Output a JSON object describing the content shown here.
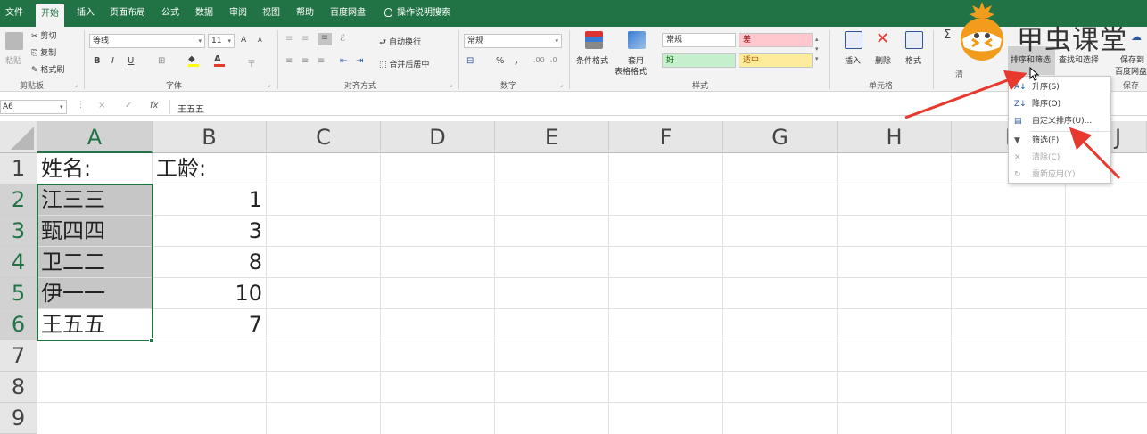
{
  "tabs": [
    "文件",
    "开始",
    "插入",
    "页面布局",
    "公式",
    "数据",
    "审阅",
    "视图",
    "帮助",
    "百度网盘"
  ],
  "tell_me": "操作说明搜索",
  "clipboard": {
    "paste": "粘贴",
    "cut": "剪切",
    "copy": "复制",
    "format_painter": "格式刷",
    "group": "剪贴板"
  },
  "font": {
    "name": "等线",
    "size": "11",
    "bold": "B",
    "italic": "I",
    "underline": "U",
    "grow": "A",
    "shrink": "A",
    "font_color_glyph": "A",
    "group": "字体"
  },
  "alignment": {
    "wrap": "自动换行",
    "merge": "合并后居中",
    "group": "对齐方式"
  },
  "number": {
    "format": "常规",
    "percent": "%",
    "comma": ",",
    "group": "数字"
  },
  "styles": {
    "conditional": "条件格式",
    "table_format": [
      "套用",
      "表格格式"
    ],
    "normal": "常规",
    "bad": "差",
    "good": "好",
    "neutral": "适中",
    "group": "样式",
    "colors": {
      "bad_bg": "#ffc7ce",
      "bad_text": "#9c0006",
      "good_bg": "#c6efce",
      "good_text": "#006100",
      "neutral_bg": "#ffeb9c",
      "neutral_text": "#9c5700"
    }
  },
  "cells": {
    "insert": "插入",
    "delete": "删除",
    "format": "格式",
    "group": "单元格"
  },
  "editing": {
    "sigma": "Σ",
    "sort_filter": "排序和筛选",
    "find_select": "查找和选择",
    "clear_partial": "清"
  },
  "save": {
    "label1": "保存到",
    "label2": "百度网盘",
    "group": "保存"
  },
  "watermark": "甲虫课堂",
  "formula_bar": {
    "name_box": "A6",
    "cancel": "×",
    "enter": "✓",
    "fx": "fx",
    "value": "王五五"
  },
  "columns": [
    "A",
    "B",
    "C",
    "D",
    "E",
    "F",
    "G",
    "H",
    "I",
    "J"
  ],
  "rows": [
    "1",
    "2",
    "3",
    "4",
    "5",
    "6",
    "7",
    "8",
    "9"
  ],
  "sheet": {
    "A1": "姓名:",
    "B1": "工龄:",
    "A2": "江三三",
    "B2": "1",
    "A3": "甄四四",
    "B3": "3",
    "A4": "卫二二",
    "B4": "8",
    "A5": "伊一一",
    "B5": "10",
    "A6": "王五五",
    "B6": "7"
  },
  "menu": {
    "asc": "升序(S)",
    "desc": "降序(O)",
    "custom": "自定义排序(U)...",
    "filter": "筛选(F)",
    "clear": "清除(C)",
    "reapply": "重新应用(Y)"
  },
  "accent_color": "#217346",
  "arrow_color": "#e8392e"
}
